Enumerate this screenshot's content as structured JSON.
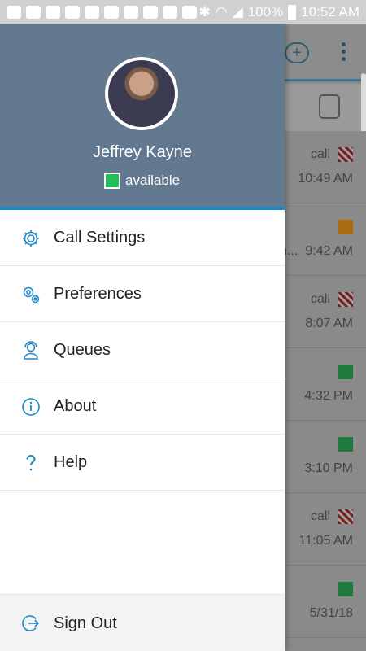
{
  "status_bar": {
    "battery": "100%",
    "time": "10:52 AM"
  },
  "background": {
    "rows": [
      {
        "label": "call",
        "mark": "hatch",
        "time": "10:49 AM"
      },
      {
        "label": "",
        "mark": "orange",
        "time": "9:42 AM"
      },
      {
        "label": "call",
        "mark": "hatch",
        "time": "8:07 AM"
      },
      {
        "label": "",
        "mark": "green",
        "time": "4:32 PM"
      },
      {
        "label": "",
        "mark": "green",
        "time": "3:10 PM"
      },
      {
        "label": "call",
        "mark": "hatch",
        "time": "11:05 AM"
      },
      {
        "label": "",
        "mark": "green",
        "time": "5/31/18"
      }
    ],
    "truncated_text": "n..."
  },
  "drawer": {
    "user_name": "Jeffrey Kayne",
    "status_label": "available",
    "status_color": "#1fbf5b",
    "header_color": "#62798f",
    "accent_color": "#1e88c8",
    "menu": [
      {
        "label": "Call Settings",
        "icon": "gear-icon"
      },
      {
        "label": "Preferences",
        "icon": "gears-icon"
      },
      {
        "label": "Queues",
        "icon": "agent-headset-icon"
      },
      {
        "label": "About",
        "icon": "info-icon"
      },
      {
        "label": "Help",
        "icon": "question-icon"
      }
    ],
    "sign_out": {
      "label": "Sign Out",
      "icon": "sign-out-icon"
    }
  }
}
